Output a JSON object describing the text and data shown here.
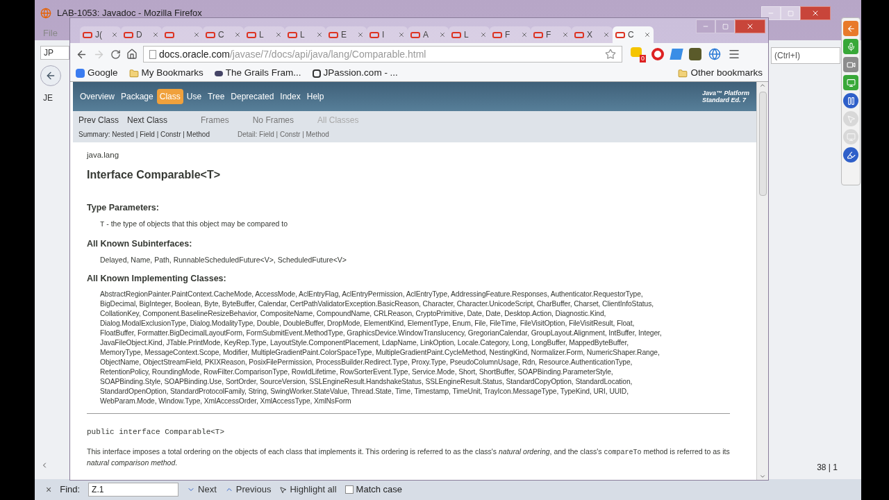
{
  "back_window": {
    "title": "LAB-1053: Javadoc - Mozilla Firefox",
    "menu": [
      "File"
    ],
    "tabs": [
      "JP",
      "JE"
    ],
    "search_field": {
      "placeholder": "(Ctrl+I)"
    },
    "status": "38 | 1",
    "find_bar": {
      "close": "×",
      "label": "Find:",
      "value": "Z.1",
      "buttons": [
        "Next",
        "Previous",
        "Highlight all"
      ],
      "match_case": {
        "label": "Match case",
        "checked": false
      }
    }
  },
  "browser": {
    "tabs": [
      {
        "label": "J(",
        "selected": false
      },
      {
        "label": "D",
        "selected": false
      },
      {
        "selected": false
      },
      {
        "label": "C",
        "selected": false
      },
      {
        "label": "L",
        "selected": false
      },
      {
        "label": "L",
        "selected": false
      },
      {
        "label": "E",
        "selected": false
      },
      {
        "label": "I",
        "selected": false
      },
      {
        "label": "A",
        "selected": false
      },
      {
        "label": "L",
        "selected": false
      },
      {
        "label": "F",
        "selected": false
      },
      {
        "label": "F",
        "selected": false
      },
      {
        "label": "X",
        "selected": false
      },
      {
        "label": "C",
        "selected": true
      }
    ],
    "address": {
      "host": "docs.oracle.com",
      "path": "/javase/7/docs/api/java/lang/Comparable.html"
    },
    "extension_badge": "0",
    "bookmarks": [
      {
        "label": "Google",
        "kind": "google"
      },
      {
        "label": "My Bookmarks",
        "kind": "folder"
      },
      {
        "label": "The Grails Fram...",
        "kind": "grails"
      },
      {
        "label": "JPassion.com - ...",
        "kind": "site"
      }
    ],
    "other_bookmarks": "Other bookmarks"
  },
  "javadoc": {
    "nav": [
      {
        "label": "Overview",
        "selected": false
      },
      {
        "label": "Package",
        "selected": false
      },
      {
        "label": "Class",
        "selected": true
      },
      {
        "label": "Use",
        "selected": false
      },
      {
        "label": "Tree",
        "selected": false
      },
      {
        "label": "Deprecated",
        "selected": false
      },
      {
        "label": "Index",
        "selected": false
      },
      {
        "label": "Help",
        "selected": false
      }
    ],
    "platform": [
      "Java™ Platform",
      "Standard Ed. 7"
    ],
    "subnav_left": [
      "Prev Class",
      "Next Class"
    ],
    "subnav_right": [
      "Frames",
      "No Frames",
      "All Classes"
    ],
    "summary": "Summary: Nested | Field | Constr | Method",
    "detail": "Detail: Field | Constr | Method",
    "package": "java.lang",
    "title": "Interface Comparable<T>",
    "type_parameters": {
      "heading": "Type Parameters:",
      "param": "T",
      "text": "- the type of objects that this object may be compared to"
    },
    "subinterfaces": {
      "heading": "All Known Subinterfaces:",
      "text": "Delayed, Name, Path, RunnableScheduledFuture<V>, ScheduledFuture<V>"
    },
    "implementing": {
      "heading": "All Known Implementing Classes:",
      "lines": [
        "AbstractRegionPainter.PaintContext.CacheMode, AccessMode, AclEntryFlag, AclEntryPermission, AclEntryType, AddressingFeature.Responses, Authenticator.RequestorType,",
        "BigDecimal, BigInteger, Boolean, Byte, ByteBuffer, Calendar, CertPathValidatorException.BasicReason, Character, Character.UnicodeScript, CharBuffer, Charset, ClientInfoStatus,",
        "CollationKey, Component.BaselineResizeBehavior, CompositeName, CompoundName, CRLReason, CryptoPrimitive, Date, Date, Desktop.Action, Diagnostic.Kind,",
        "Dialog.ModalExclusionType, Dialog.ModalityType, Double, DoubleBuffer, DropMode, ElementKind, ElementType, Enum, File, FileTime, FileVisitOption, FileVisitResult, Float,",
        "FloatBuffer, Formatter.BigDecimalLayoutForm, FormSubmitEvent.MethodType, GraphicsDevice.WindowTranslucency, GregorianCalendar, GroupLayout.Alignment, IntBuffer, Integer,",
        "JavaFileObject.Kind, JTable.PrintMode, KeyRep.Type, LayoutStyle.ComponentPlacement, LdapName, LinkOption, Locale.Category, Long, LongBuffer, MappedByteBuffer,",
        "MemoryType, MessageContext.Scope, Modifier, MultipleGradientPaint.ColorSpaceType, MultipleGradientPaint.CycleMethod, NestingKind, Normalizer.Form, NumericShaper.Range,",
        "ObjectName, ObjectStreamField, PKIXReason, PosixFilePermission, ProcessBuilder.Redirect.Type, Proxy.Type, PseudoColumnUsage, Rdn, Resource.AuthenticationType,",
        "RetentionPolicy, RoundingMode, RowFilter.ComparisonType, RowIdLifetime, RowSorterEvent.Type, Service.Mode, Short, ShortBuffer, SOAPBinding.ParameterStyle,",
        "SOAPBinding.Style, SOAPBinding.Use, SortOrder, SourceVersion, SSLEngineResult.HandshakeStatus, SSLEngineResult.Status, StandardCopyOption, StandardLocation,",
        "StandardOpenOption, StandardProtocolFamily, String, SwingWorker.StateValue, Thread.State, Time, Timestamp, TimeUnit, TrayIcon.MessageType, TypeKind, URI, UUID,",
        "WebParam.Mode, Window.Type, XmlAccessOrder, XmlAccessType, XmlNsForm"
      ]
    },
    "signature": "public interface Comparable<T>",
    "description": [
      {
        "kind": "text",
        "text": "This interface imposes a total ordering on the objects of each class that implements it. This ordering is referred to as the class's *natural ordering*, and the class's "
      },
      {
        "kind": "code",
        "text": "compareTo"
      },
      {
        "kind": "text",
        "text": " method is referred to as its *natural comparison method*."
      }
    ]
  },
  "recorder_toolbar": [
    {
      "kind": "back",
      "disabled": false
    },
    {
      "kind": "mic",
      "disabled": false
    },
    {
      "kind": "camera",
      "disabled": false
    },
    {
      "kind": "screen",
      "disabled": false
    },
    {
      "kind": "pause",
      "disabled": false
    },
    {
      "kind": "pointer",
      "disabled": true
    },
    {
      "kind": "screen",
      "disabled": true
    },
    {
      "kind": "highlighter",
      "disabled": false
    }
  ]
}
